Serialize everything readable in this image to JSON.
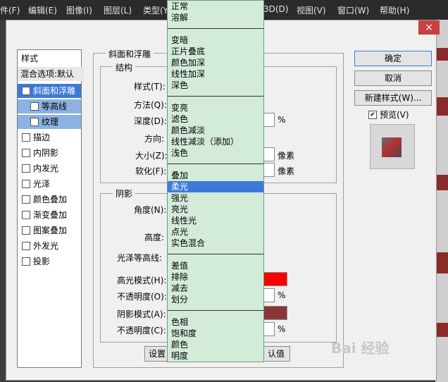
{
  "menubar": {
    "items": [
      "件(F)",
      "编辑(E)",
      "图像(I)",
      "图层(L)",
      "类型(Y)",
      "3D(D)",
      "视图(V)",
      "窗口(W)",
      "帮助(H)"
    ]
  },
  "dialog": {
    "close_label": "×",
    "styles_header": "样式",
    "blend_options": "混合选项:默认",
    "style_items": [
      {
        "label": "斜面和浮雕",
        "checked": true
      },
      {
        "label": "等高线",
        "checked": false
      },
      {
        "label": "纹理",
        "checked": false
      },
      {
        "label": "描边",
        "checked": false
      },
      {
        "label": "内阴影",
        "checked": false
      },
      {
        "label": "内发光",
        "checked": false
      },
      {
        "label": "光泽",
        "checked": false
      },
      {
        "label": "颜色叠加",
        "checked": false
      },
      {
        "label": "渐变叠加",
        "checked": false
      },
      {
        "label": "图案叠加",
        "checked": false
      },
      {
        "label": "外发光",
        "checked": false
      },
      {
        "label": "投影",
        "checked": false
      }
    ],
    "bevel_group": "斜面和浮雕",
    "structure_group": "结构",
    "labels": {
      "style": "样式(T):",
      "technique": "方法(Q):",
      "depth": "深度(D):",
      "direction": "方向:",
      "size": "大小(Z):",
      "soften": "软化(F):"
    },
    "units": {
      "percent": "%",
      "pixels": "像素"
    },
    "shading_group": "阴影",
    "shading_labels": {
      "angle": "角度(N):",
      "altitude": "高度:",
      "gloss_contour": "光泽等高线:",
      "highlight_mode": "高光模式(H):",
      "opacity1": "不透明度(O):",
      "shadow_mode": "阴影模式(A):",
      "opacity2": "不透明度(C):"
    },
    "highlight_color": "#ff0000",
    "shadow_color": "#8b3535",
    "bottom_left_btn": "设置",
    "bottom_right_btn": "认值",
    "ok": "确定",
    "cancel": "取消",
    "new_style": "新建样式(W)...",
    "preview_label": "预览(V)",
    "preview_checked": true
  },
  "dropdown": {
    "groups": [
      [
        "正常",
        "溶解"
      ],
      [
        "变暗",
        "正片叠底",
        "颜色加深",
        "线性加深",
        "深色"
      ],
      [
        "变亮",
        "滤色",
        "颜色减淡",
        "线性减淡（添加）",
        "浅色"
      ],
      [
        "叠加",
        "柔光",
        "强光",
        "亮光",
        "线性光",
        "点光",
        "实色混合"
      ],
      [
        "差值",
        "排除",
        "减去",
        "划分"
      ],
      [
        "色相",
        "饱和度",
        "颜色",
        "明度"
      ]
    ],
    "selected": "柔光"
  },
  "watermark": "Bai 经验"
}
